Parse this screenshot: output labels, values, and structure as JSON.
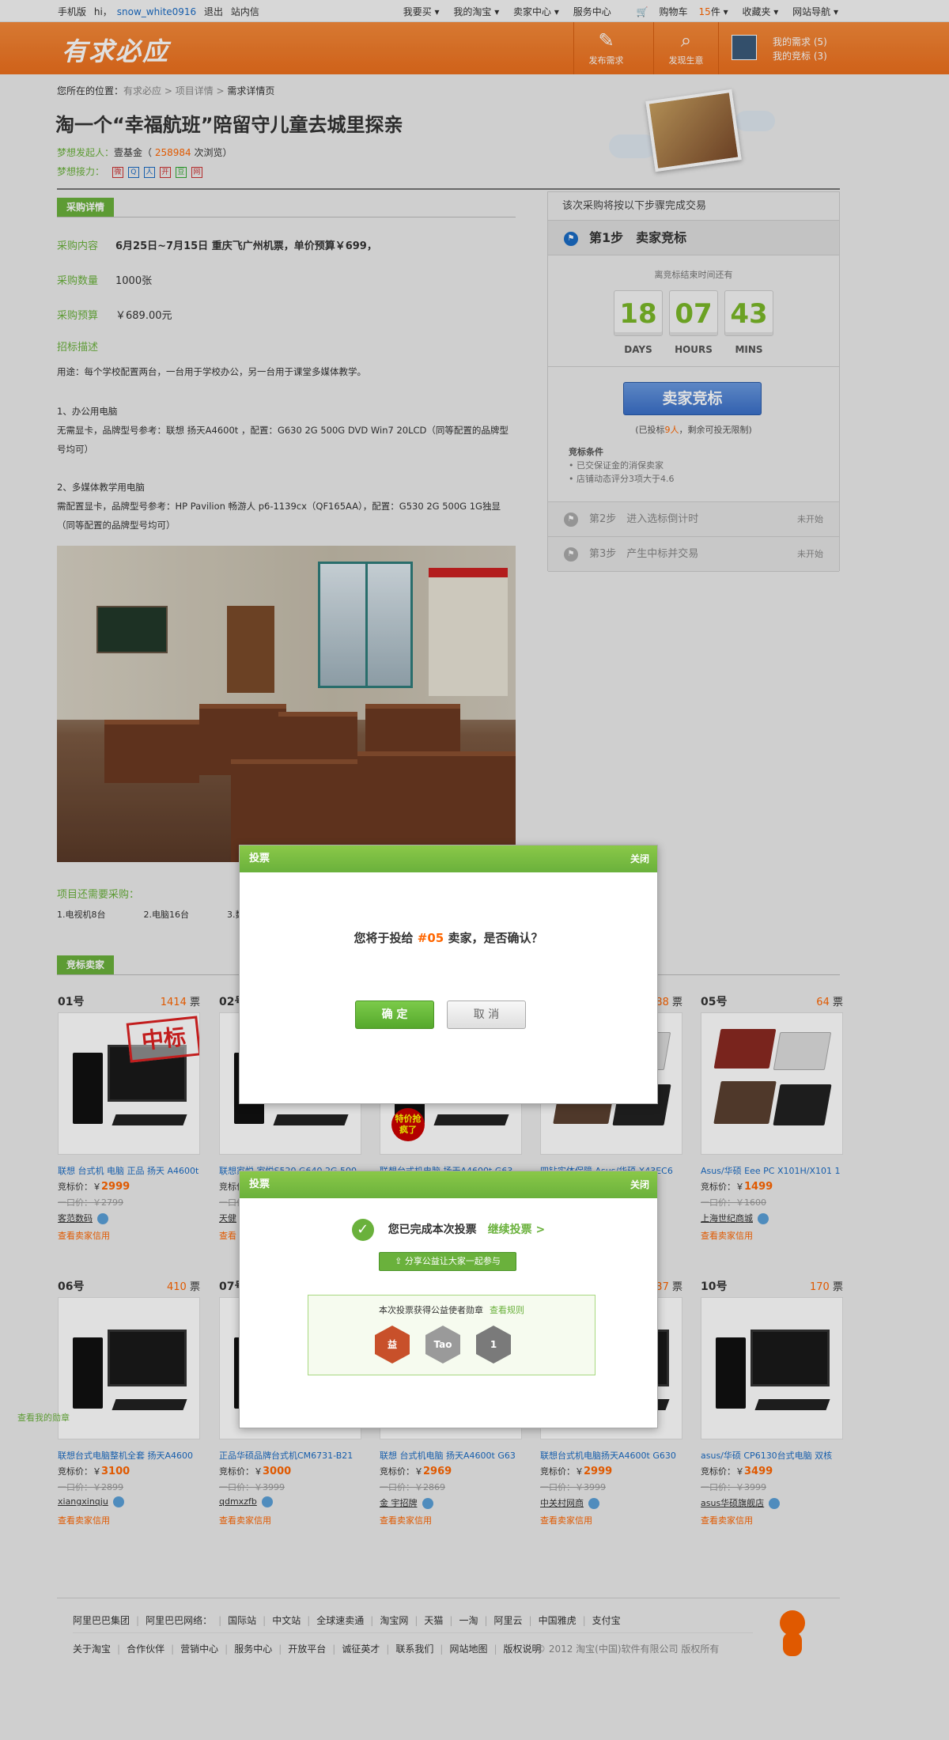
{
  "topbar": {
    "mobile": "手机版",
    "hi": "hi，",
    "username": "snow_white0916",
    "logout": "退出",
    "messages": "站内信",
    "menus": [
      "我要买 ▾",
      "我的淘宝 ▾",
      "卖家中心 ▾",
      "服务中心"
    ],
    "cart_label": "购物车",
    "cart_count": "15",
    "cart_unit": "件 ▾",
    "favorites": "收藏夹 ▾",
    "sitenav": "网站导航 ▾"
  },
  "header": {
    "logo": "有求必应",
    "publish": "发布需求",
    "discover": "发现生意",
    "my_needs": "我的需求 (5)",
    "my_bids": "我的竞标 (3)"
  },
  "breadcrumb": {
    "label": "您所在的位置：",
    "items": [
      "有求必应",
      "项目详情",
      "需求详情页"
    ]
  },
  "page_title": "淘一个“幸福航班”陪留守儿童去城里探亲",
  "meta": {
    "initiator_label": "梦想发起人：",
    "initiator": "壹基金",
    "views_prefix": "（ ",
    "views": "258984",
    "views_suffix": " 次浏览）",
    "relay_label": "梦想接力："
  },
  "purchase": {
    "section_title": "采购详情",
    "content_label": "采购内容",
    "content": "6月25日~7月15日 重庆飞广州机票，单价预算￥699，",
    "qty_label": "采购数量",
    "qty": "1000张",
    "budget_label": "采购预算",
    "budget": "￥689.00元",
    "desc_title": "招标描述",
    "desc_lines": [
      "用途：每个学校配置两台，一台用于学校办公，另一台用于课堂多媒体教学。",
      "",
      "1、办公用电脑",
      "无需显卡，品牌型号参考：联想 扬天A4600t ，配置：G630 2G 500G DVD Win7 20LCD（同等配置的品牌型号均可）",
      "",
      "2、多媒体教学用电脑",
      "需配置显卡，品牌型号参考：HP Pavilion 畅游人 p6-1139cx（QF165AA），配置：G530 2G 500G 1G独显（同等配置的品牌型号均可）"
    ]
  },
  "needs": {
    "title": "项目还需要采购：",
    "items": [
      "1.电视机8台",
      "2.电脑16台",
      "3.数"
    ]
  },
  "sellers_title": "竞标卖家",
  "steps": {
    "title": "该次采购将按以下步骤完成交易",
    "step1": "第1步　卖家竞标",
    "remain": "离竞标结束时间还有",
    "days": "18",
    "hours": "07",
    "mins": "43",
    "days_label": "DAYS",
    "hours_label": "HOURS",
    "mins_label": "MINS",
    "bid_button": "卖家竞标",
    "bid_info_a": "(已投标",
    "bid_info_n": "9人",
    "bid_info_b": "，剩余可投无限制)",
    "cond_title": "竞标条件",
    "conds": [
      "• 已交保证金的消保卖家",
      "• 店铺动态评分3项大于4.6"
    ],
    "step2": "第2步　进入选标倒计时",
    "step3": "第3步　产生中标并交易",
    "not_started": "未开始"
  },
  "products": [
    {
      "rank": "01号",
      "votes": "1414",
      "name": "联想 台式机 电脑 正品 扬天 A4600t",
      "price": "2999",
      "oprice": "一口价：￥2799",
      "seller": "客范数码",
      "shop": "查看卖家信用"
    },
    {
      "rank": "02号",
      "votes": "",
      "name": "联想家悦 家悦S520 G640 2G 500",
      "price": "",
      "oprice": "一口价",
      "seller": "天健",
      "shop": "查看"
    },
    {
      "rank": "",
      "votes": "",
      "name": "联想台式机电脑 扬天A4600t G63",
      "price": "",
      "oprice": "",
      "seller": "",
      "shop": ""
    },
    {
      "rank": "",
      "votes": "88",
      "name": "四钻实体保障 Asus/华硕 X43EC6",
      "price": "",
      "oprice": "",
      "seller": "",
      "shop": ""
    },
    {
      "rank": "05号",
      "votes": "64",
      "name": "Asus/华硕 Eee PC X101H/X101 1",
      "price": "1499",
      "oprice": "一口价：￥1600",
      "seller": "上海世纪商城",
      "shop": "查看卖家信用"
    },
    {
      "rank": "06号",
      "votes": "410",
      "name": "联想台式电脑整机全套 扬天A4600",
      "price": "3100",
      "oprice": "一口价：￥2899",
      "seller": "xiangxinqju",
      "shop": "查看卖家信用"
    },
    {
      "rank": "07号",
      "votes": "",
      "name": "正品华硕品牌台式机CM6731-B21",
      "price": "3000",
      "oprice": "一口价：￥3999",
      "seller": "qdmxzfb",
      "shop": "查看卖家信用"
    },
    {
      "rank": "",
      "votes": "",
      "name": "联想 台式机电脑 扬天A4600t G63",
      "price": "2969",
      "oprice": "一口价：￥2869",
      "seller": "金 宇招牌",
      "shop": "查看卖家信用"
    },
    {
      "rank": "",
      "votes": "37",
      "name": "联想台式机电脑扬天A4600t G630",
      "price": "2999",
      "oprice": "一口价：￥3999",
      "seller": "中关村网商",
      "shop": "查看卖家信用"
    },
    {
      "rank": "10号",
      "votes": "170",
      "name": "asus/华硕 CP6130台式电脑 双核",
      "price": "3499",
      "oprice": "一口价：￥3999",
      "seller": "asus华硕旗舰店",
      "shop": "查看卖家信用"
    }
  ],
  "labels": {
    "votes_unit": "票",
    "price_label": "竞标价：￥",
    "win_stamp": "中标",
    "sale_tag": "特价抢疯了"
  },
  "vote_dialog": {
    "title": "投票",
    "close": "关闭",
    "q_a": "您将于投给 ",
    "q_n": "#05",
    "q_b": " 卖家，是否确认？",
    "ok": "确 定",
    "cancel": "取 消"
  },
  "done_dialog": {
    "title": "投票",
    "close": "关闭",
    "done": "您已完成本次投票",
    "cont": "继续投票 >",
    "share": "分享公益让大家一起参与",
    "medal_title": "本次投票获得公益使者勋章",
    "rules": "查看规则",
    "medals": [
      "益",
      "Tao",
      "1"
    ]
  },
  "my_medal": "查看我的勋章",
  "footer": {
    "row1": [
      "阿里巴巴集团",
      "阿里巴巴网络：",
      "国际站",
      "中文站",
      "全球速卖通",
      "淘宝网",
      "天猫",
      "一淘",
      "阿里云",
      "中国雅虎",
      "支付宝"
    ],
    "row2": [
      "关于淘宝",
      "合作伙伴",
      "营销中心",
      "服务中心",
      "开放平台",
      "诚征英才",
      "联系我们",
      "网站地图",
      "版权说明"
    ],
    "copyright": "© 2012 淘宝(中国)软件有限公司 版权所有"
  },
  "colors": {
    "accent_green": "#6ab13c",
    "header_orange": "#ec6f1d",
    "price_orange": "#ff6600",
    "link_blue": "#1a6bc4"
  }
}
